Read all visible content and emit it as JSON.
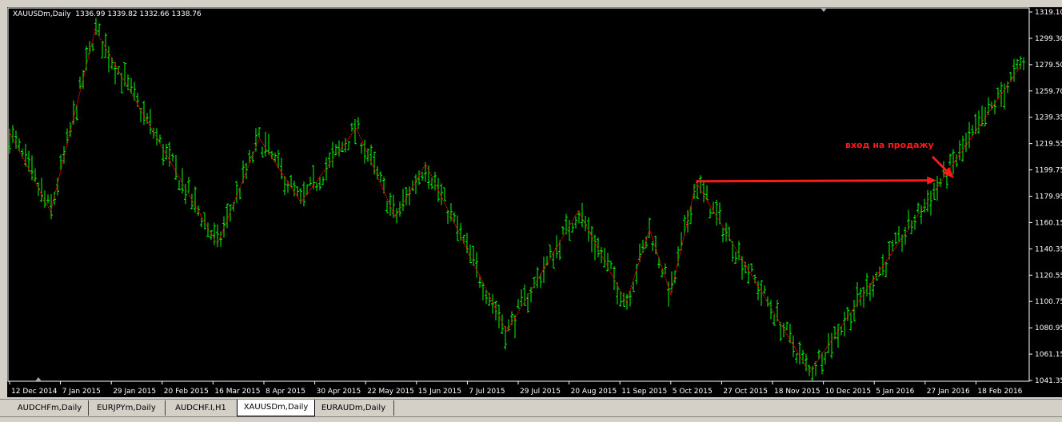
{
  "chart_header": {
    "symbol": "XAUUSDm,Daily",
    "ohlc": "1336.99 1339.82 1332.66 1338.76"
  },
  "annotation": {
    "text": "вход на продажу",
    "color": "#ff1a1a"
  },
  "tabs": [
    {
      "label": "AUDCHFm,Daily",
      "active": false
    },
    {
      "label": "EURJPYm,Daily",
      "active": false
    },
    {
      "label": "AUDCHF.I,H1",
      "active": false
    },
    {
      "label": "XAUUSDm,Daily",
      "active": true
    },
    {
      "label": "EURAUDm,Daily",
      "active": false
    }
  ],
  "colors": {
    "background": "#000000",
    "bars": "#00ff00",
    "zigzag": "#ff0000",
    "axis_text": "#ffffff"
  },
  "chart_data": {
    "type": "bar",
    "symbol": "XAUUSD",
    "timeframe": "Daily",
    "ylim": [
      1041.35,
      1319.1
    ],
    "y_ticks": [
      "1319.10",
      "1299.30",
      "1279.50",
      "1259.70",
      "1239.35",
      "1219.55",
      "1199.75",
      "1179.95",
      "1160.15",
      "1140.35",
      "1120.55",
      "1100.75",
      "1080.95",
      "1061.15",
      "1041.35"
    ],
    "x_ticks": [
      {
        "label": "12 Dec 2014",
        "date": "2014-12-12"
      },
      {
        "label": "7 Jan 2015",
        "date": "2015-01-07"
      },
      {
        "label": "29 Jan 2015",
        "date": "2015-01-29"
      },
      {
        "label": "20 Feb 2015",
        "date": "2015-02-20"
      },
      {
        "label": "16 Mar 2015",
        "date": "2015-03-16"
      },
      {
        "label": "8 Apr 2015",
        "date": "2015-04-08"
      },
      {
        "label": "30 Apr 2015",
        "date": "2015-04-30"
      },
      {
        "label": "22 May 2015",
        "date": "2015-05-22"
      },
      {
        "label": "15 Jun 2015",
        "date": "2015-06-15"
      },
      {
        "label": "7 Jul 2015",
        "date": "2015-07-07"
      },
      {
        "label": "29 Jul 2015",
        "date": "2015-07-29"
      },
      {
        "label": "20 Aug 2015",
        "date": "2015-08-20"
      },
      {
        "label": "11 Sep 2015",
        "date": "2015-09-11"
      },
      {
        "label": "5 Oct 2015",
        "date": "2015-10-05"
      },
      {
        "label": "27 Oct 2015",
        "date": "2015-10-27"
      },
      {
        "label": "18 Nov 2015",
        "date": "2015-11-18"
      },
      {
        "label": "10 Dec 2015",
        "date": "2015-12-10"
      },
      {
        "label": "5 Jan 2016",
        "date": "2016-01-05"
      },
      {
        "label": "27 Jan 2016",
        "date": "2016-01-27"
      },
      {
        "label": "18 Feb 2016",
        "date": "2016-02-18"
      }
    ],
    "zigzag": [
      {
        "date": "2014-12-12",
        "price": 1228.7
      },
      {
        "date": "2015-01-02",
        "price": 1168.5
      },
      {
        "date": "2015-01-22",
        "price": 1305.8
      },
      {
        "date": "2015-03-18",
        "price": 1143.8
      },
      {
        "date": "2015-04-06",
        "price": 1223.9
      },
      {
        "date": "2015-04-24",
        "price": 1175.7
      },
      {
        "date": "2015-05-18",
        "price": 1231.7
      },
      {
        "date": "2015-06-05",
        "price": 1164.3
      },
      {
        "date": "2015-06-19",
        "price": 1204.6
      },
      {
        "date": "2015-07-24",
        "price": 1078.1
      },
      {
        "date": "2015-08-24",
        "price": 1169.1
      },
      {
        "date": "2015-09-14",
        "price": 1100.4
      },
      {
        "date": "2015-09-25",
        "price": 1155.2
      },
      {
        "date": "2015-10-05",
        "price": 1106.4
      },
      {
        "date": "2015-10-16",
        "price": 1190.8
      },
      {
        "date": "2015-12-04",
        "price": 1047.4
      },
      {
        "date": "2016-03-09",
        "price": 1279.9
      }
    ],
    "arrow_level": {
      "from_date": "2015-10-16",
      "to_date": "2016-02-01",
      "price": 1191.5
    }
  }
}
